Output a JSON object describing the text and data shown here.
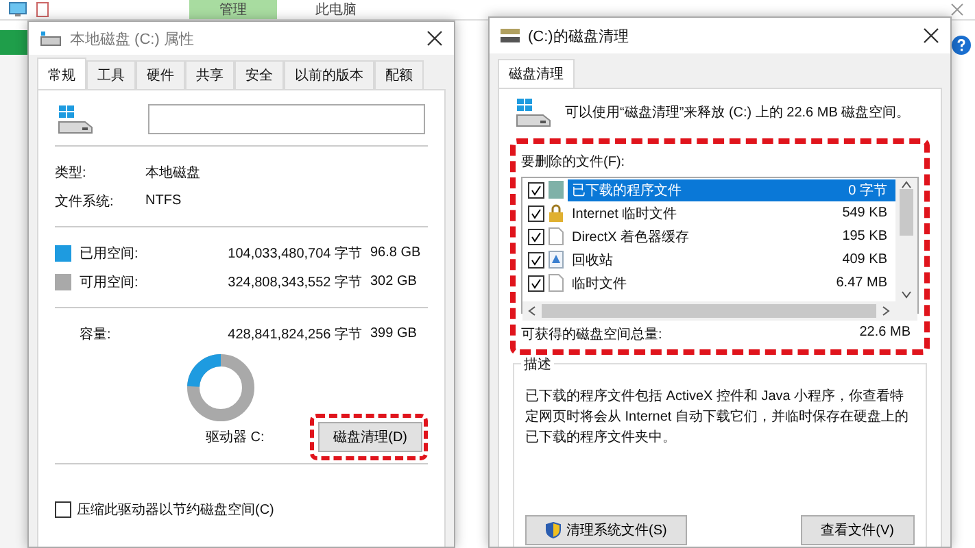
{
  "explorer": {
    "tabs": [
      {
        "label": "管理",
        "selected": true
      },
      {
        "label": "此电脑",
        "selected": false
      }
    ]
  },
  "properties": {
    "title": "本地磁盘 (C:) 属性",
    "tabs": [
      {
        "label": "常规",
        "selected": true
      },
      {
        "label": "工具",
        "selected": false
      },
      {
        "label": "硬件",
        "selected": false
      },
      {
        "label": "共享",
        "selected": false
      },
      {
        "label": "安全",
        "selected": false
      },
      {
        "label": "以前的版本",
        "selected": false
      },
      {
        "label": "配额",
        "selected": false
      }
    ],
    "info": [
      {
        "label": "类型:",
        "value": "本地磁盘"
      },
      {
        "label": "文件系统:",
        "value": "NTFS"
      }
    ],
    "space": [
      {
        "label": "已用空间:",
        "bytes": "104,033,480,704 字节",
        "size": "96.8 GB",
        "color": "#1e9be0"
      },
      {
        "label": "可用空间:",
        "bytes": "324,808,343,552 字节",
        "size": "302 GB",
        "color": "#a9a9a9"
      }
    ],
    "capacity": {
      "label": "容量:",
      "bytes": "428,841,824,256 字节",
      "size": "399 GB"
    },
    "drive_label": "驱动器 C:",
    "cleanup_button": "磁盘清理(D)",
    "compress": {
      "label": "压缩此驱动器以节约磁盘空间(C)",
      "checked": false
    }
  },
  "cleanup": {
    "title": "(C:)的磁盘清理",
    "tab": "磁盘清理",
    "intro": "可以使用“磁盘清理”来释放 (C:) 上的 22.6 MB 磁盘空间。",
    "files_label": "要删除的文件(F):",
    "files": [
      {
        "name": "已下载的程序文件",
        "size": "0 字节",
        "checked": true,
        "selected": true,
        "kind": "folder"
      },
      {
        "name": "Internet 临时文件",
        "size": "549 KB",
        "checked": true,
        "selected": false,
        "kind": "lock"
      },
      {
        "name": "DirectX 着色器缓存",
        "size": "195 KB",
        "checked": true,
        "selected": false,
        "kind": "file"
      },
      {
        "name": "回收站",
        "size": "409 KB",
        "checked": true,
        "selected": false,
        "kind": "recycle"
      },
      {
        "name": "临时文件",
        "size": "6.47 MB",
        "checked": true,
        "selected": false,
        "kind": "file"
      }
    ],
    "total_label": "可获得的磁盘空间总量:",
    "total_value": "22.6 MB",
    "description_label": "描述",
    "description": "已下载的程序文件包括 ActiveX 控件和 Java 小程序，你查看特定网页时将会从 Internet 自动下载它们，并临时保存在硬盘上的已下载的程序文件夹中。",
    "buttons": [
      {
        "label": "清理系统文件(S)",
        "kind": "shield"
      },
      {
        "label": "查看文件(V)",
        "kind": "plain"
      }
    ]
  }
}
